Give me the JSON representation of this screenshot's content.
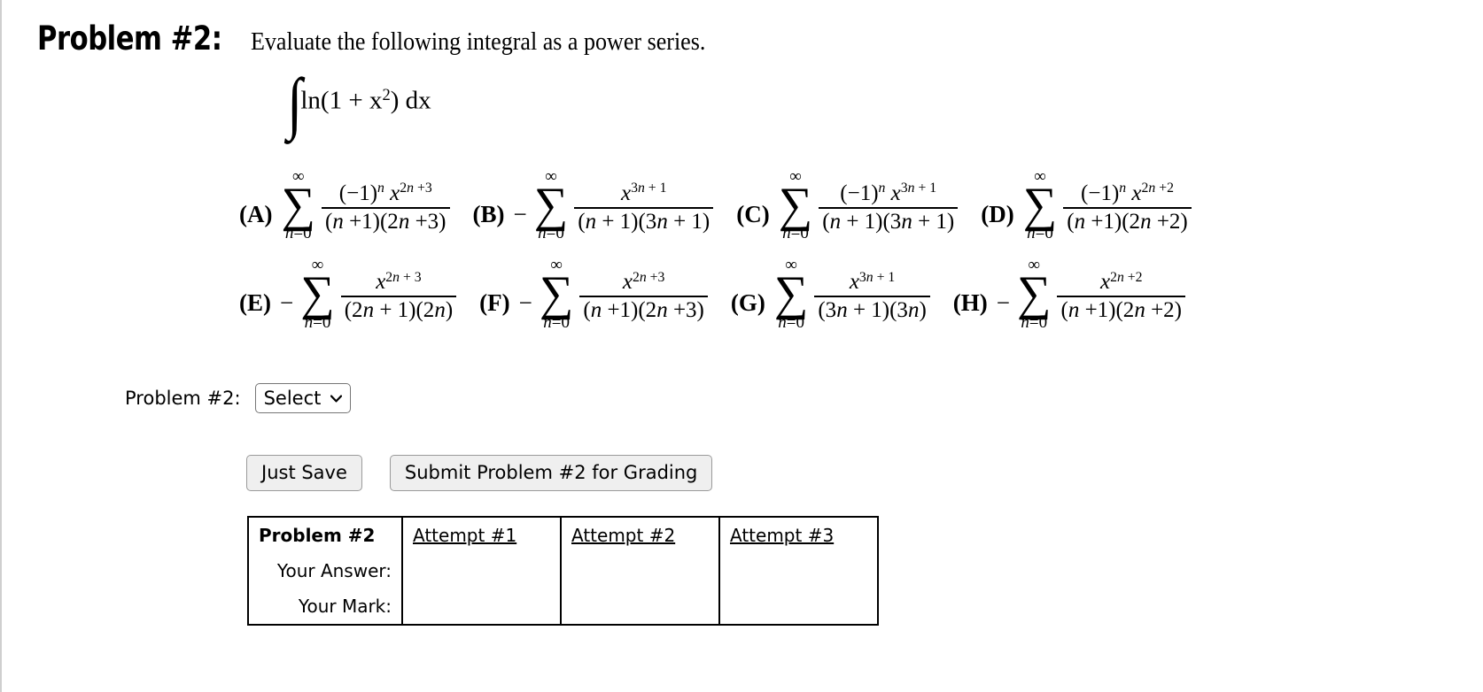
{
  "header": {
    "problem_title": "Problem #2:",
    "prompt": "Evaluate the following integral as a power series."
  },
  "integral": {
    "sign": "∫",
    "body_prefix": "ln(1 + x",
    "body_exponent": "2",
    "body_suffix": ") dx"
  },
  "sigma": {
    "glyph": "∑",
    "upper_limit": "∞",
    "lower_limit": "n=0"
  },
  "options": [
    {
      "label": "(A)",
      "sign": "",
      "numerator_html": "(−1)<span class=\"pw\"><i>n</i></span> <i>x</i><span class=\"pw\">2<i>n</i> +3</span>",
      "denominator_html": "(<i>n</i> +1)(2<i>n</i> +3)",
      "plain": "(A) sum n=0 to infinity of (-1)^n x^(2n+3) / ((n+1)(2n+3))"
    },
    {
      "label": "(B)",
      "sign": "−",
      "numerator_html": "<i>x</i><span class=\"pw\">3<i>n</i> + 1</span>",
      "denominator_html": "(<i>n</i> + 1)(3<i>n</i> + 1)",
      "plain": "(B) minus sum n=0 to infinity of x^(3n+1) / ((n+1)(3n+1))"
    },
    {
      "label": "(C)",
      "sign": "",
      "numerator_html": "(−1)<span class=\"pw\"><i>n</i></span> <i>x</i><span class=\"pw\">3<i>n</i> + 1</span>",
      "denominator_html": "(<i>n</i> + 1)(3<i>n</i> + 1)",
      "plain": "(C) sum n=0 to infinity of (-1)^n x^(3n+1) / ((n+1)(3n+1))"
    },
    {
      "label": "(D)",
      "sign": "",
      "numerator_html": "(−1)<span class=\"pw\"><i>n</i></span> <i>x</i><span class=\"pw\">2<i>n</i> +2</span>",
      "denominator_html": "(<i>n</i> +1)(2<i>n</i> +2)",
      "plain": "(D) sum n=0 to infinity of (-1)^n x^(2n+2) / ((n+1)(2n+2))"
    },
    {
      "label": "(E)",
      "sign": "−",
      "numerator_html": "<i>x</i><span class=\"pw\">2<i>n</i> + 3</span>",
      "denominator_html": "(2<i>n</i> + 1)(2<i>n</i>)",
      "plain": "(E) minus sum n=0 to infinity of x^(2n+3) / ((2n+1)(2n))"
    },
    {
      "label": "(F)",
      "sign": "−",
      "numerator_html": "<i>x</i><span class=\"pw\">2<i>n</i> +3</span>",
      "denominator_html": "(<i>n</i> +1)(2<i>n</i> +3)",
      "plain": "(F) minus sum n=0 to infinity of x^(2n+3) / ((n+1)(2n+3))"
    },
    {
      "label": "(G)",
      "sign": "",
      "numerator_html": "<i>x</i><span class=\"pw\">3<i>n</i> + 1</span>",
      "denominator_html": "(3<i>n</i> + 1)(3<i>n</i>)",
      "plain": "(G) sum n=0 to infinity of x^(3n+1) / ((3n+1)(3n))"
    },
    {
      "label": "(H)",
      "sign": "−",
      "numerator_html": "<i>x</i><span class=\"pw\">2<i>n</i> +2</span>",
      "denominator_html": "(<i>n</i> +1)(2<i>n</i> +2)",
      "plain": "(H) minus sum n=0 to infinity of x^(2n+2) / ((n+1)(2n+2))"
    }
  ],
  "answer_row": {
    "label": "Problem #2:",
    "select_value": "Select",
    "caret": "⌄"
  },
  "buttons": {
    "save_label": "Just Save",
    "submit_label": "Submit Problem #2 for Grading"
  },
  "results": {
    "corner_label": "Problem #2",
    "attempt_headers": [
      "Attempt #1",
      "Attempt #2",
      "Attempt #3"
    ],
    "row_labels": [
      "Your Answer:",
      "Your Mark:"
    ],
    "answer_cells": [
      "",
      "",
      ""
    ],
    "mark_cells": [
      "",
      "",
      ""
    ]
  }
}
